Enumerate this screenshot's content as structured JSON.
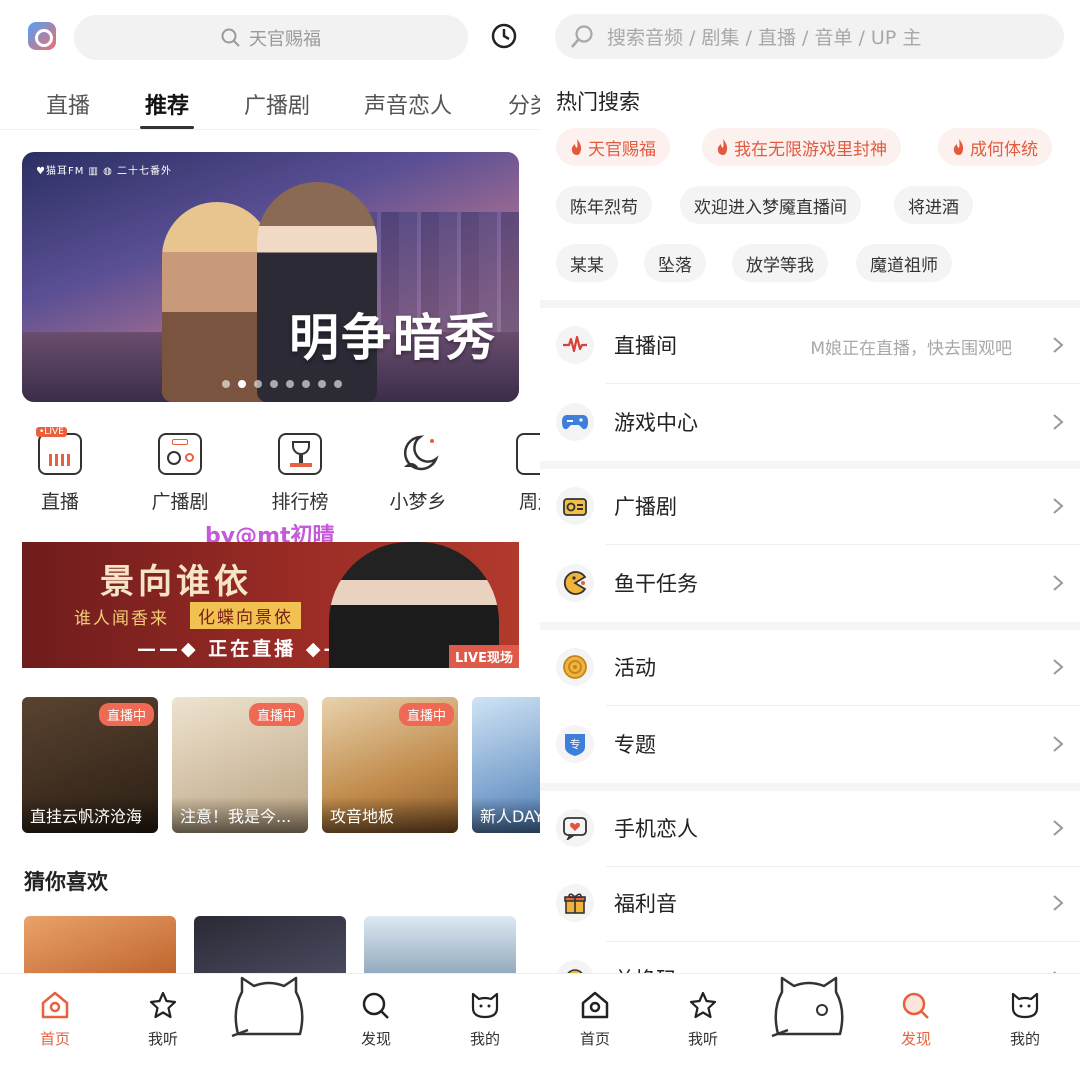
{
  "left": {
    "search": {
      "placeholder": "天官赐福"
    },
    "tabs": [
      {
        "label": "直播"
      },
      {
        "label": "推荐"
      },
      {
        "label": "广播剧"
      },
      {
        "label": "声音恋人"
      },
      {
        "label": "分类"
      }
    ],
    "banner": {
      "title": "明争暗秀",
      "logos": "♥猫耳FM  ▥  ◍  二十七番外"
    },
    "quick": [
      {
        "label": "直播",
        "icon": "live-tv-icon"
      },
      {
        "label": "广播剧",
        "icon": "radio-icon"
      },
      {
        "label": "排行榜",
        "icon": "trophy-icon"
      },
      {
        "label": "小梦乡",
        "icon": "moon-icon"
      },
      {
        "label": "周边",
        "icon": "bag-icon"
      }
    ],
    "watermark": "by@mt初晴",
    "live_banner": {
      "title": "景向谁依",
      "line1": "谁人闻香来",
      "line1b": "化蝶向景依",
      "line2": "——◆ 正在直播 ◆——",
      "tag": "LIVE现场"
    },
    "live_cards": [
      {
        "badge": "直播中",
        "caption": "直挂云帆济沧海",
        "color": "#3a2a1e"
      },
      {
        "badge": "直播中",
        "caption": "注意！我是今...",
        "color": "#cbb79c"
      },
      {
        "badge": "直播中",
        "caption": "攻音地板",
        "color": "#b98d5e"
      },
      {
        "badge": "",
        "caption": "新人DAY",
        "color": "#5d8fc4"
      }
    ],
    "guess_title": "猜你喜欢",
    "tabbar": [
      {
        "label": "首页",
        "icon": "home-icon",
        "active": true
      },
      {
        "label": "我听",
        "icon": "star-icon",
        "active": false
      },
      {
        "label": "发现",
        "icon": "discover-icon",
        "active": false
      },
      {
        "label": "我的",
        "icon": "cat-face-icon",
        "active": false
      }
    ]
  },
  "right": {
    "search": {
      "placeholder": "搜索音频 / 剧集 / 直播 / 音单 / UP 主"
    },
    "hot_title": "热门搜索",
    "chips": [
      {
        "label": "天官赐福",
        "hot": true
      },
      {
        "label": "我在无限游戏里封神",
        "hot": true
      },
      {
        "label": "成何体统",
        "hot": true
      },
      {
        "label": "陈年烈苟",
        "hot": false
      },
      {
        "label": "欢迎进入梦魇直播间",
        "hot": false
      },
      {
        "label": "将进酒",
        "hot": false
      },
      {
        "label": "某某",
        "hot": false
      },
      {
        "label": "坠落",
        "hot": false
      },
      {
        "label": "放学等我",
        "hot": false
      },
      {
        "label": "魔道祖师",
        "hot": false
      }
    ],
    "rows": [
      {
        "label": "直播间",
        "sub": "M娘正在直播，快去围观吧",
        "icon": "pulse-icon"
      },
      {
        "label": "游戏中心",
        "sub": "",
        "icon": "gamepad-icon"
      },
      {
        "label": "广播剧",
        "sub": "",
        "icon": "radio-icon"
      },
      {
        "label": "鱼干任务",
        "sub": "",
        "icon": "pacman-icon"
      },
      {
        "label": "活动",
        "sub": "",
        "icon": "target-icon"
      },
      {
        "label": "专题",
        "sub": "",
        "icon": "shield-badge-icon"
      },
      {
        "label": "手机恋人",
        "sub": "",
        "icon": "heart-chat-icon"
      },
      {
        "label": "福利音",
        "sub": "",
        "icon": "gift-icon"
      },
      {
        "label": "兑换码",
        "sub": "",
        "icon": "ticket-icon"
      }
    ],
    "tabbar": [
      {
        "label": "首页",
        "icon": "home-icon",
        "active": false
      },
      {
        "label": "我听",
        "icon": "star-icon",
        "active": false
      },
      {
        "label": "发现",
        "icon": "discover-icon",
        "active": true
      },
      {
        "label": "我的",
        "icon": "cat-face-icon",
        "active": false
      }
    ]
  }
}
